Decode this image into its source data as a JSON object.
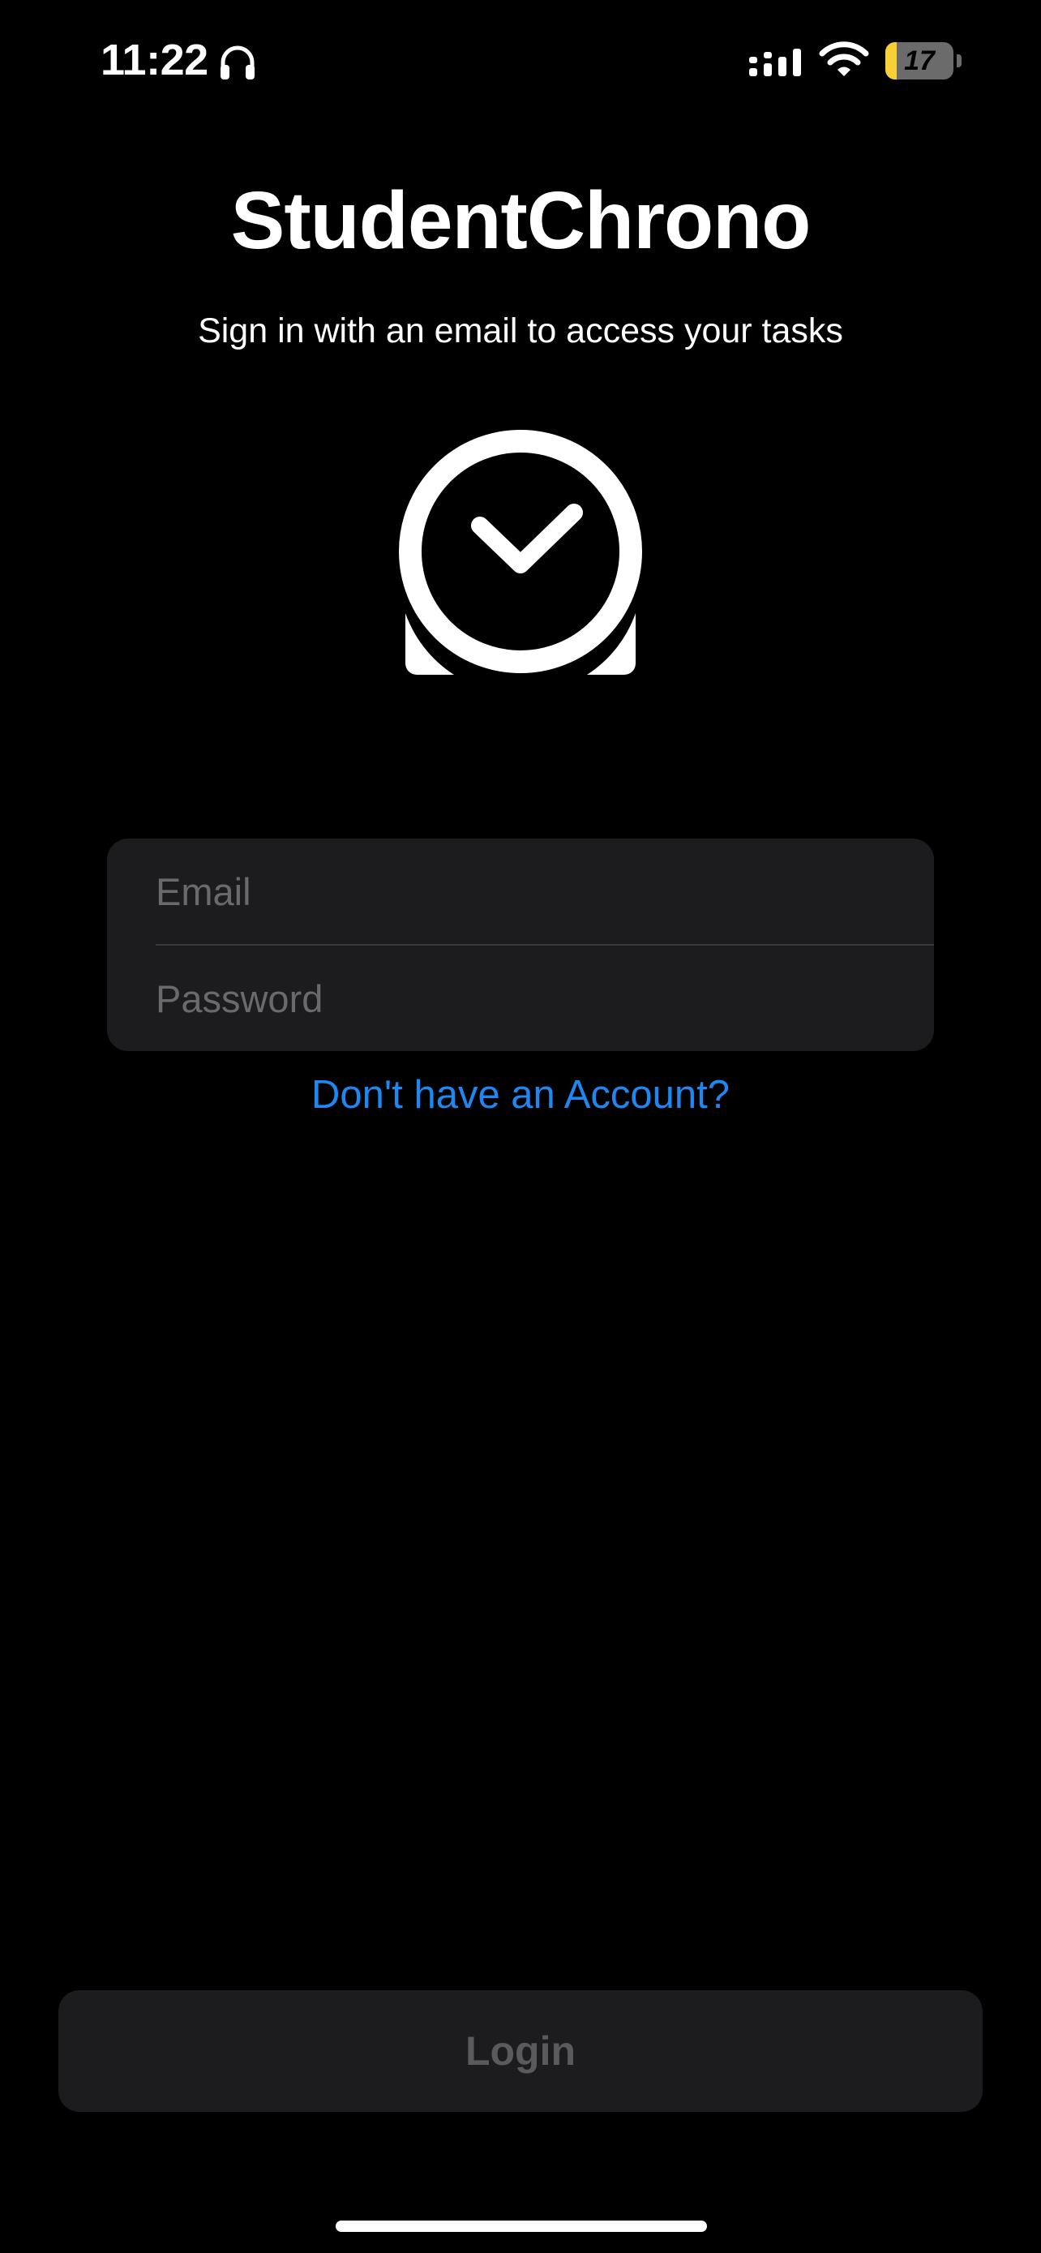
{
  "status_bar": {
    "time": "11:22",
    "battery_level": "17",
    "battery_percent": 17,
    "battery_charging": true,
    "icons": [
      "headphones-icon",
      "cellular-signal-icon",
      "wifi-icon",
      "battery-icon",
      "charging-bolt-icon"
    ]
  },
  "header": {
    "title": "StudentChrono",
    "subtitle": "Sign in with an email to access your tasks"
  },
  "logo": {
    "icon": "clock-checkmark-icon"
  },
  "form": {
    "email": {
      "placeholder": "Email",
      "value": ""
    },
    "password": {
      "placeholder": "Password",
      "value": ""
    }
  },
  "signup_link": "Don't have an Account?",
  "login_button": {
    "label": "Login",
    "enabled": false
  },
  "colors": {
    "background": "#000000",
    "field_background": "#1c1c1e",
    "link": "#1e88f0",
    "battery_fill": "#f7d038",
    "disabled_text": "#5a5a5e"
  }
}
